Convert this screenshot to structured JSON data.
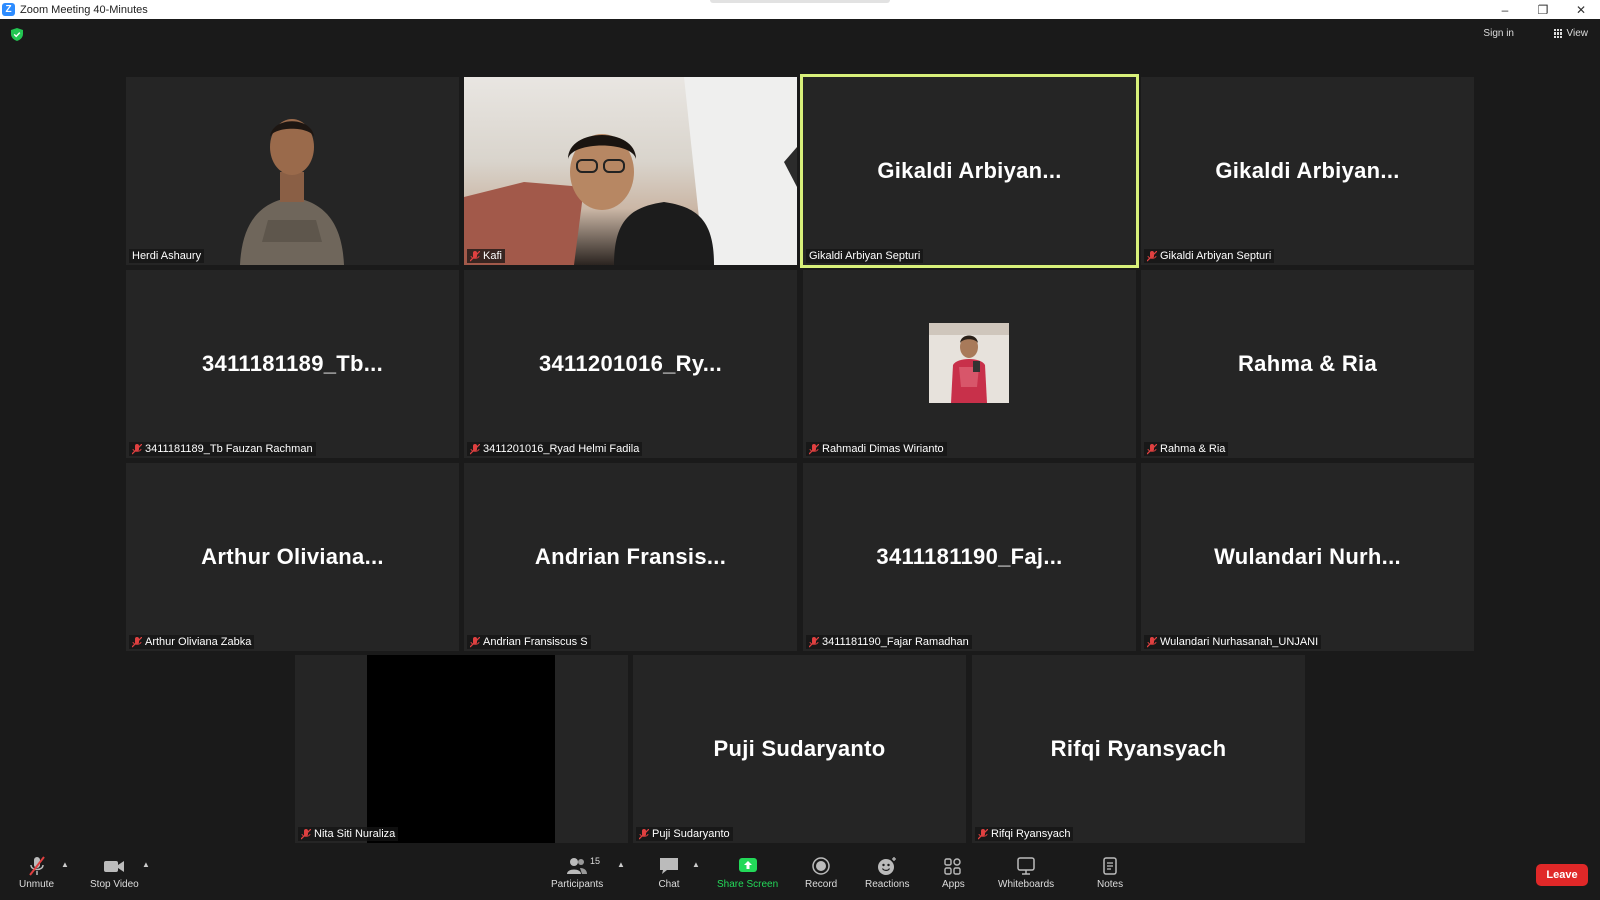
{
  "window": {
    "title": "Zoom Meeting 40-Minutes",
    "minimize": "–",
    "restore": "❐",
    "close": "✕"
  },
  "topbar": {
    "signin": "Sign in",
    "view": "View"
  },
  "tiles": [
    {
      "big": "",
      "label": "Herdi Ashaury",
      "muted": false
    },
    {
      "big": "",
      "label": "Kafi",
      "muted": true
    },
    {
      "big": "Gikaldi  Arbiyan...",
      "label": "Gikaldi Arbiyan Septuri",
      "muted": false
    },
    {
      "big": "Gikaldi  Arbiyan...",
      "label": "Gikaldi Arbiyan Septuri",
      "muted": true
    },
    {
      "big": "3411181189_Tb...",
      "label": "3411181189_Tb Fauzan Rachman",
      "muted": true
    },
    {
      "big": "3411201016_Ry...",
      "label": "3411201016_Ryad Helmi Fadila",
      "muted": true
    },
    {
      "big": "",
      "label": "Rahmadi Dimas Wirianto",
      "muted": true
    },
    {
      "big": "Rahma & Ria",
      "label": "Rahma & Ria",
      "muted": true
    },
    {
      "big": "Arthur  Oliviana...",
      "label": "Arthur Oliviana Zabka",
      "muted": true
    },
    {
      "big": "Andrian  Fransis...",
      "label": "Andrian Fransiscus S",
      "muted": true
    },
    {
      "big": "3411181190_Faj...",
      "label": "3411181190_Fajar Ramadhan",
      "muted": true
    },
    {
      "big": "Wulandari  Nurh...",
      "label": "Wulandari Nurhasanah_UNJANI",
      "muted": true
    },
    {
      "big": "",
      "label": "Nita Siti Nuraliza",
      "muted": true
    },
    {
      "big": "Puji Sudaryanto",
      "label": "Puji Sudaryanto",
      "muted": true
    },
    {
      "big": "Rifqi Ryansyach",
      "label": "Rifqi Ryansyach",
      "muted": true
    }
  ],
  "toolbar": {
    "unmute": "Unmute",
    "stop_video": "Stop Video",
    "participants": "Participants",
    "participants_count": "15",
    "chat": "Chat",
    "share_screen": "Share Screen",
    "record": "Record",
    "reactions": "Reactions",
    "apps": "Apps",
    "whiteboards": "Whiteboards",
    "notes": "Notes",
    "leave": "Leave"
  },
  "colors": {
    "active_speaker_border": "#d8f07a",
    "share_green": "#23d959",
    "leave_red": "#e02828",
    "muted_red": "#e04040"
  }
}
